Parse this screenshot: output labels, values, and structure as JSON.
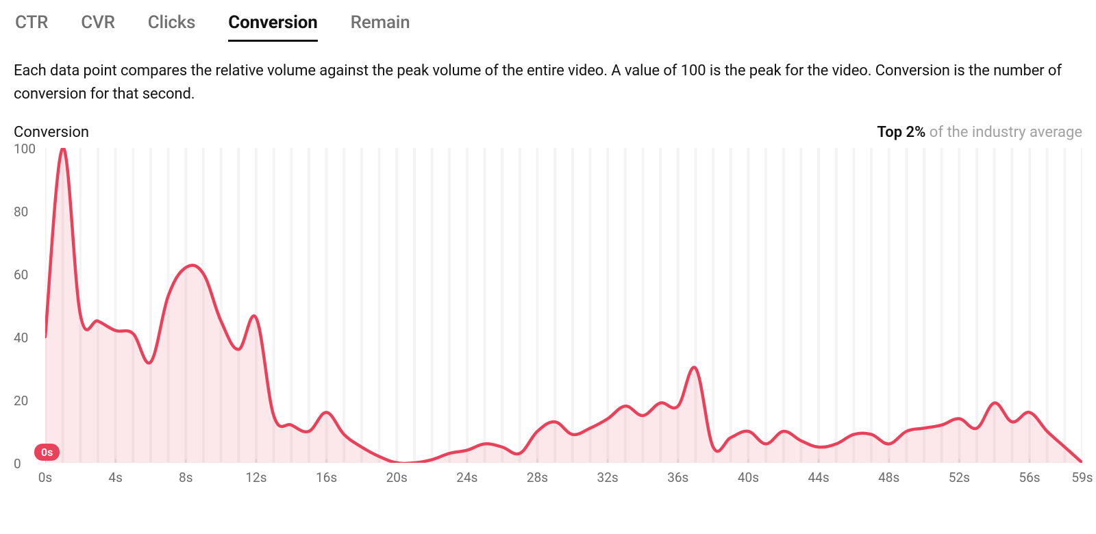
{
  "tabs": [
    {
      "label": "CTR",
      "active": false
    },
    {
      "label": "CVR",
      "active": false
    },
    {
      "label": "Clicks",
      "active": false
    },
    {
      "label": "Conversion",
      "active": true
    },
    {
      "label": "Remain",
      "active": false
    }
  ],
  "description": "Each data point compares the relative volume against the peak volume of the entire video. A value of 100 is the peak for the video. Conversion is the number of conversion for that second.",
  "chart_title": "Conversion",
  "rank_label_strong": "Top 2%",
  "rank_label_muted": " of the industry average",
  "marker_label": "0s",
  "colors": {
    "line": "#e9415a",
    "fill": "rgba(233,65,90,0.12)"
  },
  "chart_data": {
    "type": "area",
    "title": "Conversion",
    "xlabel": "",
    "ylabel": "",
    "ylim": [
      0,
      100
    ],
    "x": [
      0,
      1,
      2,
      3,
      4,
      5,
      6,
      7,
      8,
      9,
      10,
      11,
      12,
      13,
      14,
      15,
      16,
      17,
      18,
      19,
      20,
      21,
      22,
      23,
      24,
      25,
      26,
      27,
      28,
      29,
      30,
      31,
      32,
      33,
      34,
      35,
      36,
      37,
      38,
      39,
      40,
      41,
      42,
      43,
      44,
      45,
      46,
      47,
      48,
      49,
      50,
      51,
      52,
      53,
      54,
      55,
      56,
      57,
      58,
      59
    ],
    "values": [
      40,
      100,
      47,
      45,
      42,
      41,
      32,
      53,
      62,
      60,
      45,
      36,
      46,
      15,
      12,
      10,
      16,
      9,
      5,
      2,
      0,
      0,
      1,
      3,
      4,
      6,
      5,
      3,
      10,
      13,
      9,
      11,
      14,
      18,
      15,
      19,
      18,
      30,
      5,
      8,
      10,
      6,
      10,
      7,
      5,
      6,
      9,
      9,
      6,
      10,
      11,
      12,
      14,
      11,
      19,
      13,
      16,
      10,
      5,
      0
    ],
    "x_tick_labels": [
      "0s",
      "4s",
      "8s",
      "12s",
      "16s",
      "20s",
      "24s",
      "28s",
      "32s",
      "36s",
      "40s",
      "44s",
      "48s",
      "52s",
      "56s",
      "59s"
    ],
    "x_tick_positions": [
      0,
      4,
      8,
      12,
      16,
      20,
      24,
      28,
      32,
      36,
      40,
      44,
      48,
      52,
      56,
      59
    ],
    "y_tick_labels": [
      "100",
      "80",
      "60",
      "40",
      "20",
      "0"
    ],
    "y_tick_values": [
      100,
      80,
      60,
      40,
      20,
      0
    ]
  }
}
